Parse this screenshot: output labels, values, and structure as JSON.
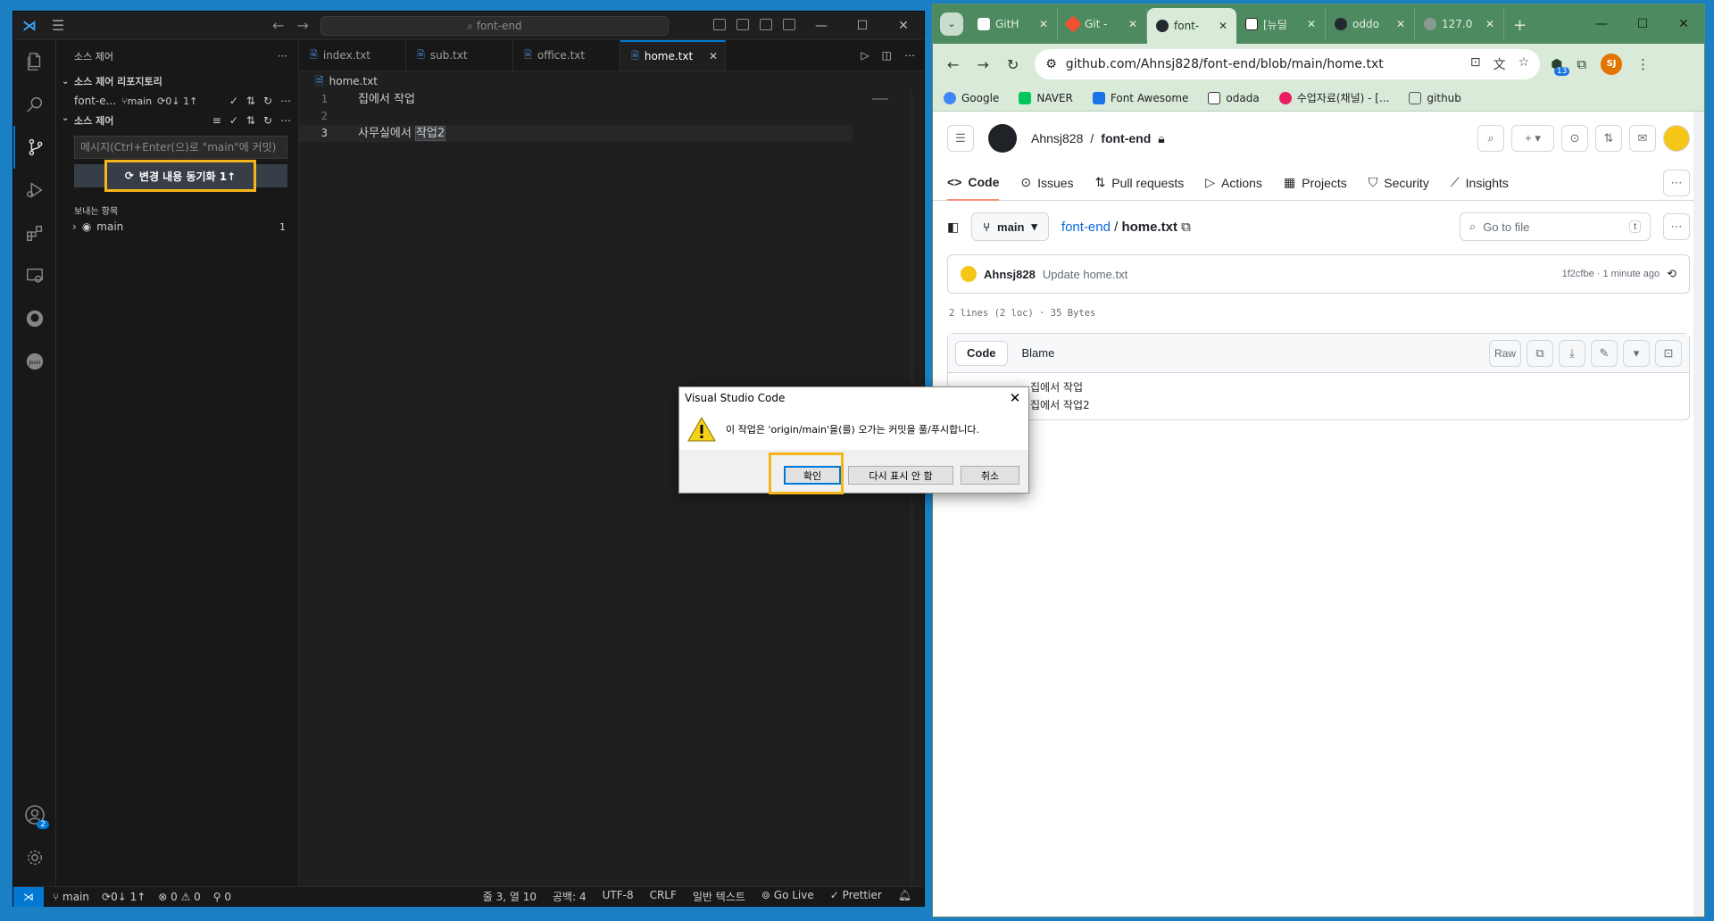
{
  "vscode": {
    "search_text": "font-end",
    "sidebar": {
      "header": "소스 제어",
      "repos_header": "소스 제어 리포지토리",
      "repo_name": "font-e...",
      "repo_branch": "main",
      "repo_sync": "0↓ 1↑",
      "scm_header": "소스 제어",
      "message_placeholder": "메시지(Ctrl+Enter(으)로 \"main\"에 커밋)",
      "sync_button_label": "변경 내용 동기화 1↑",
      "outgoing_header": "보내는 항목",
      "outgoing_branch": "main",
      "outgoing_count": "1"
    },
    "tabs": [
      {
        "label": "index.txt"
      },
      {
        "label": "sub.txt"
      },
      {
        "label": "office.txt"
      },
      {
        "label": "home.txt"
      }
    ],
    "breadcrumb": "home.txt",
    "code": {
      "lines": [
        {
          "num": "1",
          "text": "집에서 작업",
          "sel": ""
        },
        {
          "num": "2",
          "text": "",
          "sel": ""
        },
        {
          "num": "3",
          "text": "사무실에서 ",
          "sel": "작업2"
        }
      ]
    },
    "status": {
      "branch": "main",
      "sync": "0↓ 1↑",
      "problems": "⊗ 0 ⚠ 0",
      "ports": "0",
      "position": "줄 3, 열 10",
      "spaces": "공백: 4",
      "encoding": "UTF-8",
      "eol": "CRLF",
      "language": "일반 텍스트",
      "golive": "Go Live",
      "prettier": "Prettier"
    },
    "accounts_badge": "2"
  },
  "chrome": {
    "tabs": [
      {
        "label": "GitH",
        "icon_color": "#ffffff"
      },
      {
        "label": "Git -",
        "icon_color": "#f05133"
      },
      {
        "label": "font-",
        "icon_color": "#24292f"
      },
      {
        "label": "[뉴딜",
        "icon_color": "#ffffff"
      },
      {
        "label": "oddo",
        "icon_color": "#24292f"
      },
      {
        "label": "127.0",
        "icon_color": "#8a9a8e"
      }
    ],
    "url": "github.com/Ahnsj828/font-end/blob/main/home.txt",
    "ext_badge": "13",
    "profile": "SJ",
    "bookmarks": [
      {
        "label": "Google"
      },
      {
        "label": "NAVER"
      },
      {
        "label": "Font Awesome"
      },
      {
        "label": "odada"
      },
      {
        "label": "수업자료(채널) - [..."
      },
      {
        "label": "github"
      }
    ]
  },
  "github": {
    "owner": "Ahnsj828",
    "repo": "font-end",
    "nav": [
      {
        "label": "Code"
      },
      {
        "label": "Issues"
      },
      {
        "label": "Pull requests"
      },
      {
        "label": "Actions"
      },
      {
        "label": "Projects"
      },
      {
        "label": "Security"
      },
      {
        "label": "Insights"
      }
    ],
    "branch": "main",
    "path_repo": "font-end",
    "path_file": "home.txt",
    "goto_placeholder": "Go to file",
    "goto_key": "t",
    "commit_author": "Ahnsj828",
    "commit_message": "Update home.txt",
    "commit_meta": "1f2cfbe · 1 minute ago",
    "file_meta": "2 lines (2 loc) · 35 Bytes",
    "view_code": "Code",
    "view_blame": "Blame",
    "raw_label": "Raw",
    "file_lines": [
      "집에서 작업",
      "집에서 작업2"
    ]
  },
  "dialog": {
    "title": "Visual Studio Code",
    "message": "이 작업은 'origin/main'을(를) 오가는 커밋을 풀/푸시합니다.",
    "ok": "확인",
    "dont_show": "다시 표시 안 함",
    "cancel": "취소"
  }
}
